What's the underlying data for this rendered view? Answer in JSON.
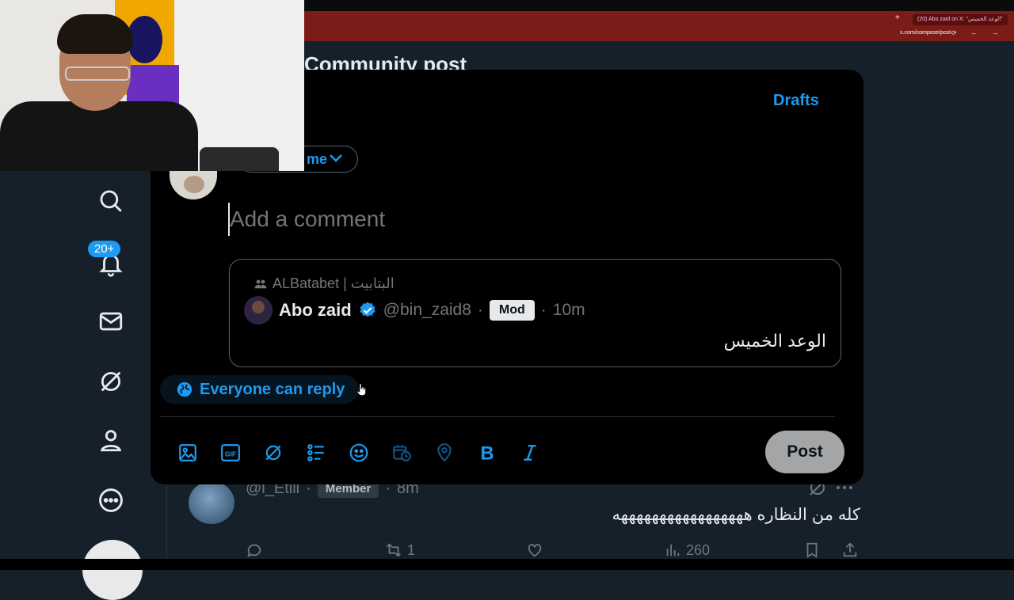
{
  "browser": {
    "tab_title": "(20) Abo zaid on X: \"الوعد الخميس\"",
    "tab_close": "X",
    "new_tab": "+",
    "url": "x.com/compose/post"
  },
  "background": {
    "title": "Community post"
  },
  "sidebar": {
    "notification_count": "20+",
    "icons": [
      "search-icon",
      "bell-icon",
      "mail-icon",
      "grok-icon",
      "profile-icon",
      "more-icon"
    ]
  },
  "composer": {
    "drafts_label": "Drafts",
    "audience_label": "me",
    "placeholder": "Add a comment",
    "reply_setting": "Everyone can reply",
    "post_label": "Post",
    "toolbar_icons": [
      "image-icon",
      "gif-icon",
      "grok-icon",
      "poll-icon",
      "emoji-icon",
      "schedule-icon",
      "location-icon",
      "bold-icon",
      "italic-icon"
    ]
  },
  "quoted_post": {
    "community": "ALBatabet | البتابيت",
    "author_name": "Abo zaid",
    "handle": "@bin_zaid8",
    "separator": "·",
    "role_badge": "Mod",
    "time": "10m",
    "text": "الوعد الخميس"
  },
  "reply": {
    "handle": "@l_Etlil",
    "role_badge": "Member",
    "time": "8m",
    "text": "كله من النظاره هههههههههههههههههه",
    "retweets": "1",
    "views": "260"
  },
  "colors": {
    "accent": "#1d9bf0",
    "modal_bg": "#000000",
    "page_bg": "#15202b",
    "browser_bar": "#7a1c18"
  }
}
